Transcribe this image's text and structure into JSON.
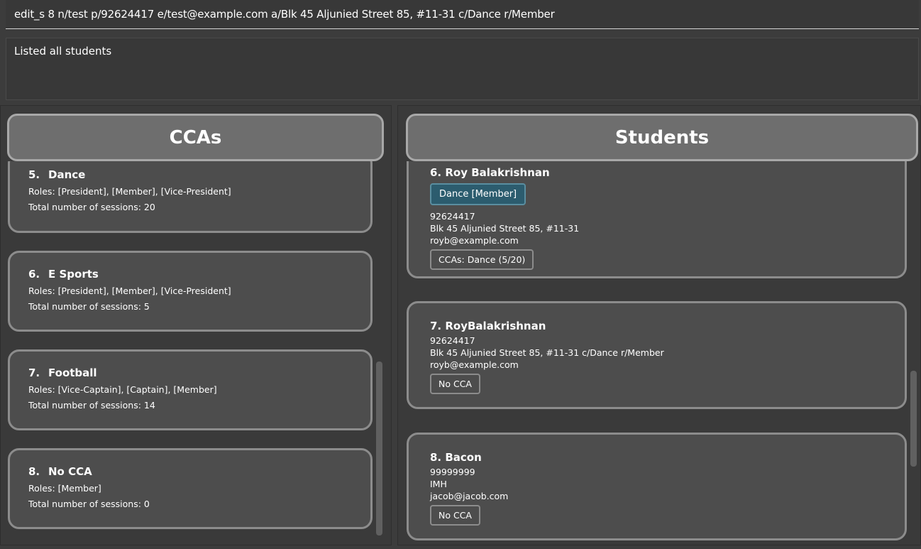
{
  "command": {
    "value": "edit_s 8 n/test p/92624417 e/test@example.com a/Blk 45 Aljunied Street 85, #11-31 c/Dance r/Member"
  },
  "result": {
    "text": "Listed all students"
  },
  "ccas": {
    "header": "CCAs",
    "items": [
      {
        "index": "5.",
        "name": "Dance",
        "roles": "Roles: [President], [Member], [Vice-President]",
        "sessions": "Total number of sessions: 20"
      },
      {
        "index": "6.",
        "name": "E Sports",
        "roles": "Roles: [President], [Member], [Vice-President]",
        "sessions": "Total number of sessions: 5"
      },
      {
        "index": "7.",
        "name": "Football",
        "roles": "Roles: [Vice-Captain], [Captain], [Member]",
        "sessions": "Total number of sessions: 14"
      },
      {
        "index": "8.",
        "name": "No CCA",
        "roles": "Roles: [Member]",
        "sessions": "Total number of sessions: 0"
      }
    ]
  },
  "students": {
    "header": "Students",
    "items": [
      {
        "title": "6. Roy Balakrishnan",
        "role_tag": "Dance [Member]",
        "phone": "92624417",
        "address": "Blk 45 Aljunied Street 85, #11-31",
        "email": "royb@example.com",
        "cca_tag": "CCAs: Dance (5/20)"
      },
      {
        "title": "7. RoyBalakrishnan",
        "phone": "92624417",
        "address": "Blk 45 Aljunied Street 85, #11-31 c/Dance r/Member",
        "email": "royb@example.com",
        "cca_tag": "No CCA"
      },
      {
        "title": "8. Bacon",
        "phone": "99999999",
        "address": "IMH",
        "email": "jacob@jacob.com",
        "cca_tag": "No CCA"
      }
    ]
  },
  "colors": {
    "background": "#3c3c3c",
    "card": "#4d4d4d",
    "card_border": "#8c8c8c",
    "header": "#6e6e6e",
    "role_tag": "#2c5c6e"
  }
}
